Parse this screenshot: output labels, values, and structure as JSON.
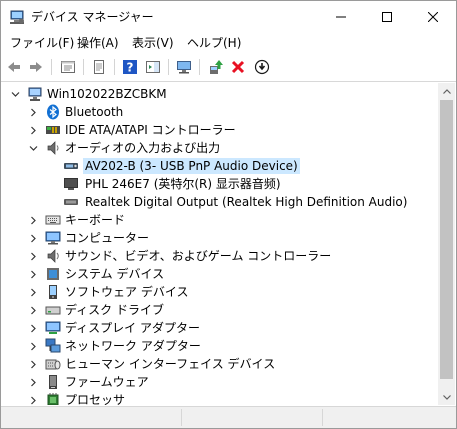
{
  "window": {
    "title": "デバイス マネージャー"
  },
  "menu": {
    "items": [
      "ファイル(F)",
      "操作(A)",
      "表示(V)",
      "ヘルプ(H)"
    ]
  },
  "toolbar": {
    "buttons": [
      "back-icon",
      "forward-icon",
      "properties-view-icon",
      "driver-details-icon",
      "help-icon",
      "action-pane-icon",
      "display-icon",
      "update-driver-icon",
      "uninstall-icon",
      "scan-hardware-icon"
    ]
  },
  "tree": {
    "root": "Win102022BZCBKM",
    "categories": [
      {
        "label": "Bluetooth",
        "icon": "bluetooth-icon",
        "expanded": false
      },
      {
        "label": "IDE ATA/ATAPI コントローラー",
        "icon": "ide-controller-icon",
        "expanded": false
      },
      {
        "label": "オーディオの入力および出力",
        "icon": "speaker-icon",
        "expanded": true,
        "children": [
          {
            "label": "AV202-B (3- USB PnP Audio Device)",
            "icon": "audio-device-icon",
            "selected": true
          },
          {
            "label": "PHL 246E7 (英特尔(R) 显示器音频)",
            "icon": "monitor-icon",
            "selected": false
          },
          {
            "label": "Realtek Digital Output (Realtek High Definition Audio)",
            "icon": "digital-output-icon",
            "selected": false
          }
        ]
      },
      {
        "label": "キーボード",
        "icon": "keyboard-icon",
        "expanded": false
      },
      {
        "label": "コンピューター",
        "icon": "computer-icon",
        "expanded": false
      },
      {
        "label": "サウンド、ビデオ、およびゲーム コントローラー",
        "icon": "sound-icon",
        "expanded": false
      },
      {
        "label": "システム デバイス",
        "icon": "system-device-icon",
        "expanded": false
      },
      {
        "label": "ソフトウェア デバイス",
        "icon": "software-device-icon",
        "expanded": false
      },
      {
        "label": "ディスク ドライブ",
        "icon": "disk-drive-icon",
        "expanded": false
      },
      {
        "label": "ディスプレイ アダプター",
        "icon": "display-adapter-icon",
        "expanded": false
      },
      {
        "label": "ネットワーク アダプター",
        "icon": "network-adapter-icon",
        "expanded": false
      },
      {
        "label": "ヒューマン インターフェイス デバイス",
        "icon": "hid-icon",
        "expanded": false
      },
      {
        "label": "ファームウェア",
        "icon": "firmware-icon",
        "expanded": false
      },
      {
        "label": "プロセッサ",
        "icon": "processor-icon",
        "expanded": false
      }
    ]
  },
  "colors": {
    "selection": "#cce8ff",
    "uninstall_red": "#e81123",
    "help_blue": "#1e56c4"
  }
}
